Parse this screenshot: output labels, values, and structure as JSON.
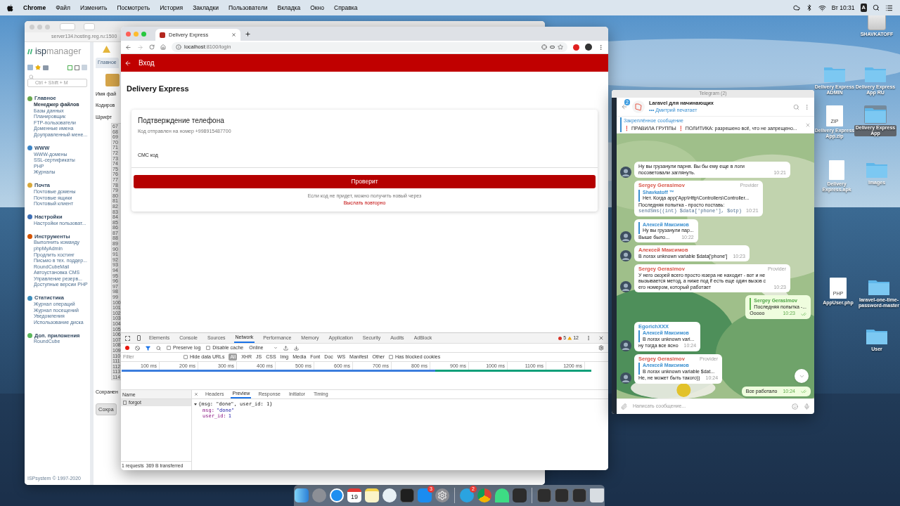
{
  "menu_bar": {
    "app_name": "Chrome",
    "items": [
      "Файл",
      "Изменить",
      "Посмотреть",
      "История",
      "Закладки",
      "Пользователи",
      "Вкладка",
      "Окно",
      "Справка"
    ],
    "input_source": "A",
    "clock": "Вт 10:31"
  },
  "isp_window": {
    "address": "server134.hosting.reg.ru:1500",
    "logo": "**isp**manager",
    "search_placeholder": "Ctrl + Shift + M",
    "sections": [
      {
        "title": "Главное",
        "items": [
          {
            "label": "Менеджер файлов",
            "selected": true
          },
          {
            "label": "Базы данных",
            "selected": false
          },
          {
            "label": "Планировщик",
            "selected": false
          },
          {
            "label": "FTP-пользователи",
            "selected": false
          },
          {
            "label": "Доменные имена",
            "selected": false
          },
          {
            "label": "Доуправленный мене...",
            "selected": false
          }
        ]
      },
      {
        "title": "WWW",
        "items": [
          {
            "label": "WWW-домены",
            "selected": false
          },
          {
            "label": "SSL-сертификаты",
            "selected": false
          },
          {
            "label": "PHP",
            "selected": false
          },
          {
            "label": "Журналы",
            "selected": false
          }
        ]
      },
      {
        "title": "Почта",
        "items": [
          {
            "label": "Почтовые домены",
            "selected": false
          },
          {
            "label": "Почтовые ящики",
            "selected": false
          },
          {
            "label": "Почтовый клиент",
            "selected": false
          }
        ]
      },
      {
        "title": "Настройки",
        "items": [
          {
            "label": "Настройки пользоват...",
            "selected": false
          }
        ]
      },
      {
        "title": "Инструменты",
        "items": [
          {
            "label": "Выполнить команду",
            "selected": false
          },
          {
            "label": "phpMyAdmin",
            "selected": false
          },
          {
            "label": "Продлить хостинг",
            "selected": false
          },
          {
            "label": "Письмо в тех. поддер...",
            "selected": false
          },
          {
            "label": "RoundCubeMail",
            "selected": false
          },
          {
            "label": "Автоустановка CMS",
            "selected": false
          },
          {
            "label": "Управление резерв...",
            "selected": false
          },
          {
            "label": "Доступные версии PHP",
            "selected": false
          }
        ]
      },
      {
        "title": "Статистика",
        "items": [
          {
            "label": "Журнал операций",
            "selected": false
          },
          {
            "label": "Журнал посещений",
            "selected": false
          },
          {
            "label": "Уведомления",
            "selected": false
          },
          {
            "label": "Использование диска",
            "selected": false
          }
        ]
      },
      {
        "title": "Доп. приложения",
        "items": [
          {
            "label": "RoundCube",
            "selected": false
          }
        ]
      }
    ],
    "footer": "ISPsystem © 1997-2020",
    "tab": "Главное",
    "field_labels": [
      "Имя фай",
      "Кодиров",
      "Шрифт"
    ],
    "line_numbers": [
      "67",
      "68",
      "69",
      "70",
      "71",
      "72",
      "73",
      "74",
      "75",
      "76",
      "77",
      "78",
      "79",
      "80",
      "81",
      "82",
      "83",
      "84",
      "85",
      "86",
      "87",
      "88",
      "89",
      "90",
      "91",
      "92",
      "93",
      "94",
      "95",
      "96",
      "97",
      "98",
      "99",
      "100",
      "101",
      "102",
      "103",
      "104",
      "105",
      "106",
      "107",
      "108",
      "109",
      "110",
      "111",
      "112",
      "113",
      "114"
    ],
    "save_label": "Сохранен",
    "save_button": "Сохра"
  },
  "browser": {
    "tab_title": "Delivery Express",
    "url": "**localhost**:8100/login",
    "app_bar_title": "Вход",
    "page_title": "Delivery Express",
    "card": {
      "title": "Подтверждение телефона",
      "subtitle": "Код отправлен на номер +998915487700",
      "field_label": "СМС код",
      "button": "Проверит",
      "resend_note": "Если код не придет, можно получить новый через",
      "resend_link": "Выслать повторно"
    },
    "devtools": {
      "tabs": [
        {
          "label": "Elements",
          "selected": false
        },
        {
          "label": "Console",
          "selected": false
        },
        {
          "label": "Sources",
          "selected": false
        },
        {
          "label": "Network",
          "selected": true
        },
        {
          "label": "Performance",
          "selected": false
        },
        {
          "label": "Memory",
          "selected": false
        },
        {
          "label": "Application",
          "selected": false
        },
        {
          "label": "Security",
          "selected": false
        },
        {
          "label": "Audits",
          "selected": false
        },
        {
          "label": "AdBlock",
          "selected": false
        }
      ],
      "error_count": "5",
      "warning_count": "12",
      "recording": true,
      "preserve_log": {
        "label": "Preserve log",
        "checked": false
      },
      "disable_cache": {
        "label": "Disable cache",
        "checked": false
      },
      "throttling": "Online",
      "filter_placeholder": "Filter",
      "hide_data_urls": {
        "label": "Hide data URLs",
        "checked": false
      },
      "type_filters": [
        {
          "label": "All",
          "selected": true
        },
        {
          "label": "XHR",
          "selected": false
        },
        {
          "label": "JS",
          "selected": false
        },
        {
          "label": "CSS",
          "selected": false
        },
        {
          "label": "Img",
          "selected": false
        },
        {
          "label": "Media",
          "selected": false
        },
        {
          "label": "Font",
          "selected": false
        },
        {
          "label": "Doc",
          "selected": false
        },
        {
          "label": "WS",
          "selected": false
        },
        {
          "label": "Manifest",
          "selected": false
        },
        {
          "label": "Other",
          "selected": false
        }
      ],
      "blocked_cookies": {
        "label": "Has blocked cookies",
        "checked": false
      },
      "timeline_ticks": [
        "100 ms",
        "200 ms",
        "300 ms",
        "400 ms",
        "500 ms",
        "600 ms",
        "700 ms",
        "800 ms",
        "900 ms",
        "1000 ms",
        "1100 ms",
        "1200 ms"
      ],
      "name_header": "Name",
      "requests": [
        {
          "name": "forgot",
          "selected": true
        }
      ],
      "detail_tabs": [
        {
          "label": "Headers",
          "selected": false
        },
        {
          "label": "Preview",
          "selected": true
        },
        {
          "label": "Response",
          "selected": false
        },
        {
          "label": "Initiator",
          "selected": false
        },
        {
          "label": "Timing",
          "selected": false
        }
      ],
      "preview": {
        "summary": "{msg: \"done\", user_id: 1}",
        "expanded": true,
        "fields": [
          {
            "key": "msg:",
            "value": "\"done\""
          },
          {
            "key": "user_id:",
            "value": "1"
          }
        ]
      },
      "summary": [
        "1 requests",
        "369 B transferred"
      ]
    }
  },
  "telegram": {
    "window_title": "Telegram (2)",
    "unread_badge": "2",
    "chat_title": "Laravel для начинающих",
    "status": "••• Дмитрий печатает",
    "pinned": {
      "title": "Закреплённое сообщение",
      "text": "❗ ПРАВИЛА ГРУППЫ ❗ ПОЛИТИКА: разрешено всё, что не запрещено..."
    },
    "messages": [
      {
        "kind": "in",
        "avatar": true,
        "text": "Ну вы грузанули парня. Вы бы ему еще в логи посоветовали заглянуть.",
        "time": "10:21"
      },
      {
        "kind": "in",
        "avatar": false,
        "sender": "Sergey Gerasimov",
        "color": "#d9564a",
        "role": "Provider",
        "reply": {
          "author": "Shavkatoff ™",
          "text": "Нет. Когда  app('App\\Http\\Controllers\\Controller..."
        },
        "text": "Последняя попытка - просто поставь:",
        "code": "sendSms((int) $data['phone'], $otp)",
        "time": "10:21"
      },
      {
        "kind": "in",
        "avatar": true,
        "reply": {
          "author": "Алексей Максимов",
          "text": "Ну вы грузанули пар..."
        },
        "text": "Выше было...",
        "time": "10:22"
      },
      {
        "kind": "in",
        "avatar": true,
        "sender": "Алексей Максимов",
        "color": "#d9564a",
        "text": "В логах unknown variable $data['phone']",
        "time": "10:23"
      },
      {
        "kind": "in",
        "avatar": true,
        "sender": "Sergey Gerasimov",
        "color": "#d9564a",
        "role": "Provider",
        "text": "У него скорей всего просто юзера не находит - вот и не вызывается метод, а ниже под if есть еще один вызов с его номером, который работает",
        "time": "10:23"
      },
      {
        "kind": "out",
        "reply": {
          "author": "Sergey Gerasimov",
          "text": "Последняя попытка -..."
        },
        "text": "Ооооо",
        "time": "10:23",
        "read": true
      },
      {
        "kind": "in",
        "avatar": true,
        "sender": "EgorichXXX",
        "color": "#3a8fd0",
        "reply": {
          "author": "Алексей Максимов",
          "text": "В логах unknown vari..."
        },
        "text": "ну тогда все ясно",
        "time": "10:24"
      },
      {
        "kind": "in",
        "avatar": true,
        "sender": "Sergey Gerasimov",
        "color": "#d9564a",
        "role": "Provider",
        "reply": {
          "author": "Алексей Максимов",
          "text": "В логах unknown variable $dat..."
        },
        "text": "Не, не может быть такого))",
        "time": "10:24"
      },
      {
        "kind": "out",
        "text": "Все работало",
        "time": "10:24",
        "read": true
      }
    ],
    "input_placeholder": "Написать сообщение..."
  },
  "desktop_icons": [
    {
      "label": "SHAVKATOFF",
      "kind": "drive",
      "selected": false
    },
    {
      "label": "Delivery Express ADMIN",
      "kind": "folder",
      "selected": false
    },
    {
      "label": "Delivery Express App RU",
      "kind": "folder",
      "selected": false
    },
    {
      "label": "Delivery Express App.zip",
      "kind": "zip",
      "icon_text": "ZIP",
      "selected": false
    },
    {
      "label": "Delivery Express App",
      "kind": "folder",
      "selected": true
    },
    {
      "label": "Delivery Express.apk",
      "kind": "document",
      "selected": false
    },
    {
      "label": "Images",
      "kind": "folder",
      "selected": false
    },
    {
      "label": "AppUser.php",
      "kind": "php",
      "icon_text": "PHP",
      "selected": false
    },
    {
      "label": "laravel-one-time-password-master",
      "kind": "folder",
      "selected": false
    },
    {
      "label": "User",
      "kind": "folder",
      "selected": false
    }
  ],
  "dock": [
    {
      "kind": "finder"
    },
    {
      "kind": "launchpad"
    },
    {
      "kind": "safari"
    },
    {
      "kind": "calendar",
      "text": "19"
    },
    {
      "kind": "notes"
    },
    {
      "kind": "pinwheel"
    },
    {
      "kind": "terminal"
    },
    {
      "kind": "appstore",
      "badge": "3"
    },
    {
      "kind": "settings"
    },
    {
      "kind": "separator"
    },
    {
      "kind": "telegram",
      "badge": "2"
    },
    {
      "kind": "chrome"
    },
    {
      "kind": "android"
    },
    {
      "kind": "editor"
    },
    {
      "kind": "separator"
    },
    {
      "kind": "window"
    },
    {
      "kind": "window"
    },
    {
      "kind": "window"
    },
    {
      "kind": "trash"
    }
  ]
}
